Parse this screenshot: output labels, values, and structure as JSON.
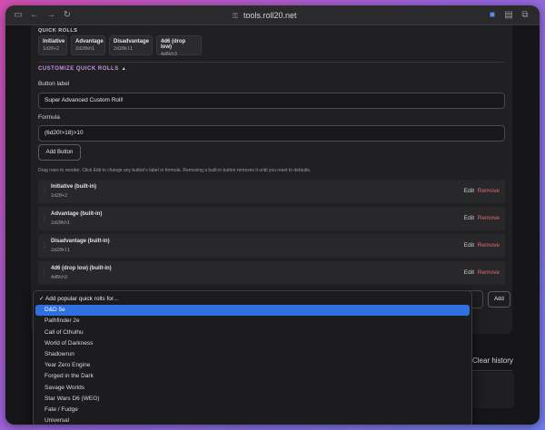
{
  "browser": {
    "url": "tools.roll20.net",
    "icons": [
      "sidebar-icon",
      "back-icon",
      "forward-icon",
      "reload-icon",
      "lock-icon",
      "extension-icon",
      "reader-icon",
      "tabs-icon"
    ]
  },
  "quick_rolls": {
    "title": "QUICK ROLLS",
    "buttons": [
      {
        "label": "Initiative",
        "formula": "1d20+2"
      },
      {
        "label": "Advantage",
        "formula": "2d20kh1"
      },
      {
        "label": "Disadvantage",
        "formula": "2d20kl1"
      },
      {
        "label": "4d6 (drop low)",
        "formula": "4d6kh3"
      }
    ]
  },
  "customize": {
    "title": "CUSTOMIZE QUICK ROLLS",
    "caret": "▲",
    "button_label_label": "Button label",
    "button_label_value": "Super Advanced Custom Roll!",
    "formula_label": "Formula",
    "formula_value": "(6d20!>18)>10",
    "add_button": "Add Button",
    "hint": "Drag rows to reorder. Click Edit to change any button's label or formula. Removing a built-in button removes it until you reset to defaults.",
    "rows": [
      {
        "title": "Initiative (built-in)",
        "formula": "1d20+2"
      },
      {
        "title": "Advantage (built-in)",
        "formula": "2d20kh1"
      },
      {
        "title": "Disadvantage (built-in)",
        "formula": "2d20kl1"
      },
      {
        "title": "4d6 (drop low) (built-in)",
        "formula": "4d6kh3"
      }
    ],
    "edit_label": "Edit",
    "remove_label": "Remove",
    "add_label": "Add"
  },
  "dropdown": {
    "header": "✓ Add popular quick rolls for...",
    "options": [
      "D&D 5e",
      "Pathfinder 2e",
      "Call of Cthulhu",
      "World of Darkness",
      "Shadowrun",
      "Year Zero Engine",
      "Forged in the Dark",
      "Savage Worlds",
      "Star Wars D6 (WEG)",
      "Fate / Fudge",
      "Universal"
    ],
    "selected": "D&D 5e",
    "selected_color": "#2f6fe0"
  },
  "history": {
    "clear_label": "Clear history"
  },
  "colors": {
    "accent_purple": "#c792e3",
    "remove_red": "#e36b6b"
  }
}
